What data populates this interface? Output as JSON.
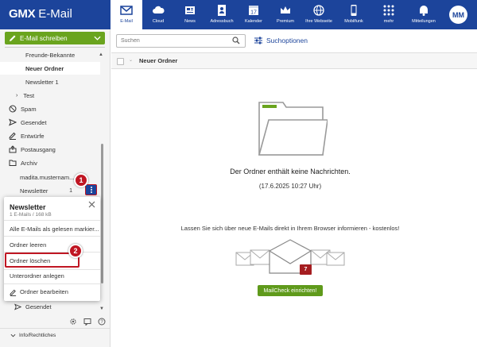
{
  "app": {
    "logo_brand": "GMX",
    "logo_product": "E-Mail"
  },
  "nav": [
    {
      "label": "E-Mail",
      "icon": "envelope-icon",
      "active": true
    },
    {
      "label": "Cloud",
      "icon": "cloud-icon"
    },
    {
      "label": "News",
      "icon": "newspaper-icon"
    },
    {
      "label": "Adressbuch",
      "icon": "address-book-icon"
    },
    {
      "label": "Kalender",
      "icon": "calendar-icon",
      "day": "17"
    },
    {
      "label": "Premium",
      "icon": "crown-icon"
    },
    {
      "label": "Ihre Webseite",
      "icon": "globe-icon"
    },
    {
      "label": "Mobilfunk",
      "icon": "phone-icon"
    },
    {
      "label": "mehr",
      "icon": "grid-icon"
    },
    {
      "label": "Mitteilungen",
      "icon": "bell-icon"
    }
  ],
  "user": {
    "initials": "MM"
  },
  "sidebar": {
    "compose_label": "E-Mail schreiben",
    "folders": {
      "freunde": "Freunde-Bekannte",
      "neuer_ordner": "Neuer Ordner",
      "newsletter1": "Newsletter 1",
      "test": "Test",
      "spam": "Spam",
      "gesendet": "Gesendet",
      "entwuerfe": "Entwürfe",
      "postausgang": "Postausgang",
      "archiv": "Archiv",
      "account": "madita.musternam...",
      "newsletter": "Newsletter",
      "newsletter_count": "1",
      "gesendet2": "Gesendet"
    },
    "info_link": "Info/Rechtliches"
  },
  "steps": {
    "one": "1",
    "two": "2"
  },
  "context_menu": {
    "title": "Newsletter",
    "subtitle": "1 E-Mails / 168 kB",
    "items": {
      "mark_read": "Alle E-Mails als gelesen markier...",
      "empty": "Ordner leeren",
      "delete": "Ordner löschen",
      "create_sub": "Unterordner anlegen",
      "edit": "Ordner bearbeiten"
    }
  },
  "search": {
    "placeholder": "Suchen",
    "options_label": "Suchoptionen"
  },
  "main": {
    "folder_title": "Neuer Ordner",
    "empty_message": "Der Ordner enthält keine Nachrichten.",
    "empty_date": "(17.6.2025 10:27 Uhr)",
    "promo_text": "Lassen Sie sich über neue E-Mails direkt in Ihrem Browser informieren - kostenlos!",
    "envelope_count": "7",
    "mailcheck_button": "MailCheck einrichten!"
  },
  "colors": {
    "brand_blue": "#1c449b",
    "green": "#6aa41e",
    "highlight_red": "#c01623"
  }
}
